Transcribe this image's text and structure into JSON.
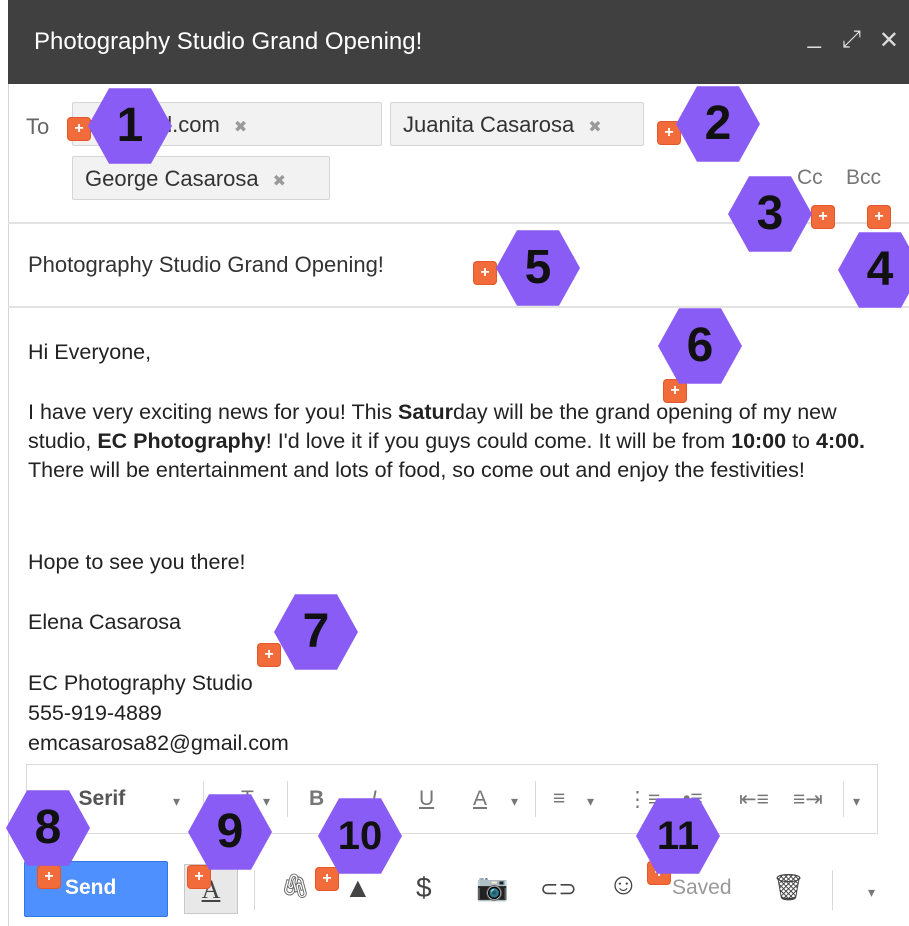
{
  "window": {
    "title": "Photography Studio Grand Opening!",
    "minimize_glyph": "_",
    "expand_glyph": "⤢",
    "close_glyph": "✕"
  },
  "recipients": {
    "to_label": "To",
    "chips": [
      {
        "text": "o@gmail.com"
      },
      {
        "text": "Juanita Casarosa"
      },
      {
        "text": "George Casarosa"
      }
    ],
    "remove_glyph": "✖",
    "cc_label": "Cc",
    "bcc_label": "Bcc"
  },
  "subject": "Photography Studio Grand Opening!",
  "body": {
    "greeting": "Hi Everyone,",
    "para_part1": "I have very exciting news for you! This ",
    "para_bold1": "Satur",
    "para_part2": "day will be the grand opening of my new studio, ",
    "para_bold2": "EC Photography",
    "para_part3": "! I'd love it if you guys could come. It will be from ",
    "para_bold3": "10:00",
    "para_part4": " to ",
    "para_bold4": "4:00.",
    "para_part5": " There will be entertainment and lots of food, so come out and enjoy the festivities!",
    "closing": "Hope to see you there!",
    "signature_name": "Elena Casarosa",
    "signature_studio": "EC Photography Studio",
    "signature_phone": "555-919-4889",
    "signature_email": "emcasarosa82@gmail.com"
  },
  "format_toolbar": {
    "font_label": "s Serif",
    "font_caret": "▾",
    "size_glyph": "T",
    "size_caret": "▾",
    "bold": "B",
    "italic": "I",
    "underline": "U",
    "text_color": "A",
    "color_caret": "▾",
    "align_glyph": "≡",
    "align_caret": "▾",
    "numbered_glyph": "⋮≡",
    "bulleted_glyph": "•≡",
    "indent_less_glyph": "⇤≡",
    "indent_more_glyph": "≡⇥",
    "more_caret": "▾"
  },
  "bottom_bar": {
    "send_label": "Send",
    "format_toggle_glyph": "A",
    "attach_icon": "paperclip-icon",
    "attach_glyph": "🖇",
    "drive_glyph": "▲",
    "money_glyph": "$",
    "photo_glyph": "📷",
    "link_glyph": "⊂⊃",
    "emoji_glyph": "☺",
    "saved_text": "Saved",
    "trash_glyph": "🗑",
    "more_caret": "▾"
  },
  "annotations": {
    "plus_glyph": "+",
    "numbers": [
      "1",
      "2",
      "3",
      "4",
      "5",
      "6",
      "7",
      "8",
      "9",
      "10",
      "11"
    ]
  },
  "colors": {
    "titlebar": "#404040",
    "send_button": "#4d90fe",
    "marker": "#f26b3a",
    "callout": "#8a5cf6"
  }
}
